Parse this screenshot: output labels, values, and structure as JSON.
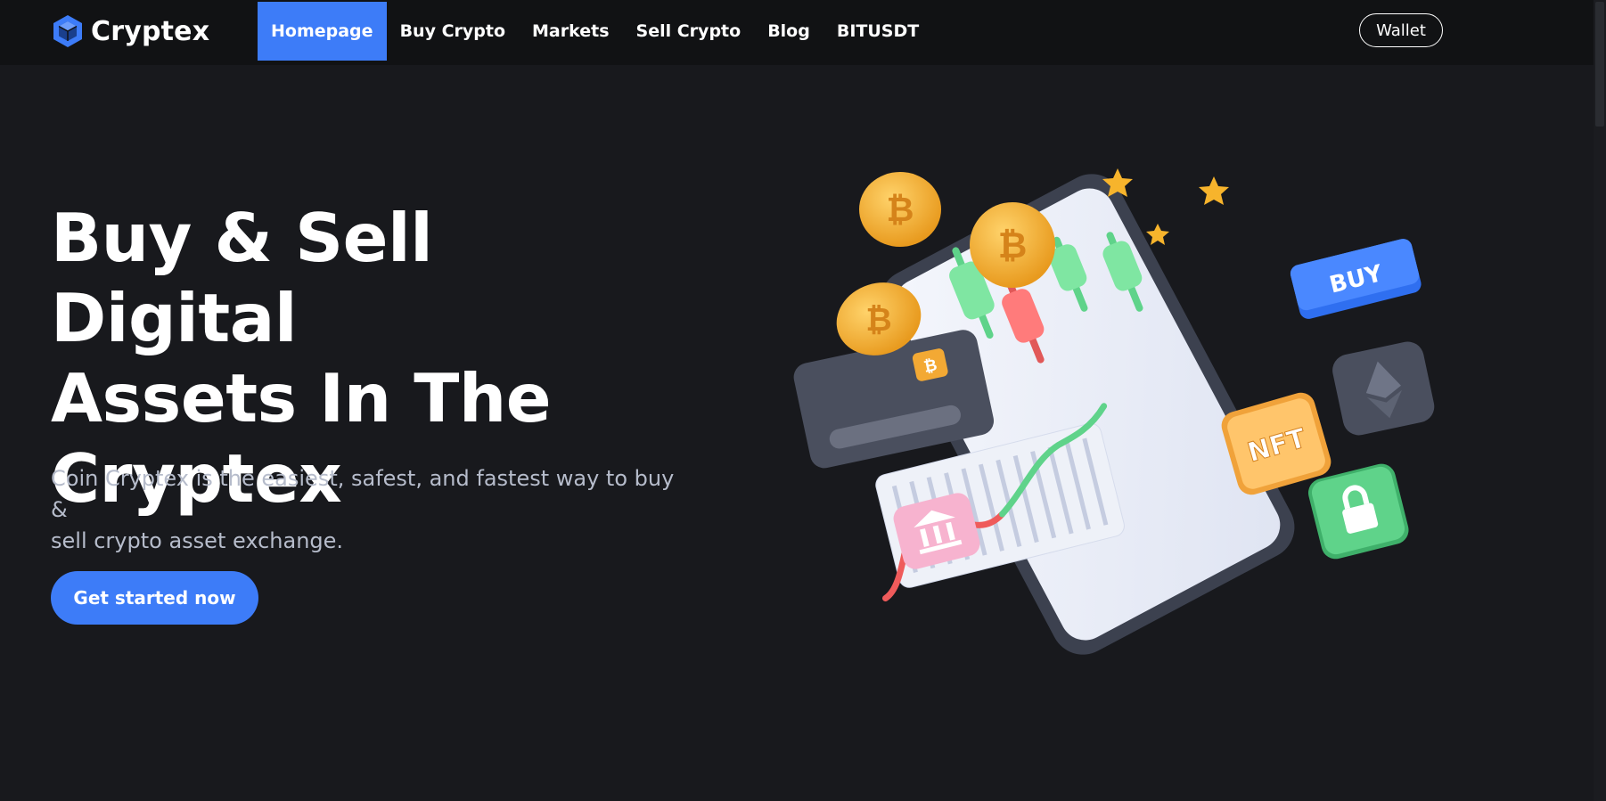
{
  "brand": {
    "name": "Cryptex",
    "icon": "cube-icon",
    "accent": "#3d7cf8"
  },
  "nav": {
    "items": [
      {
        "label": "Homepage",
        "active": true
      },
      {
        "label": "Buy Crypto"
      },
      {
        "label": "Markets"
      },
      {
        "label": "Sell Crypto"
      },
      {
        "label": "Blog"
      },
      {
        "label": "BITUSDT"
      }
    ],
    "wallet_label": "Wallet"
  },
  "hero": {
    "title_lines": [
      "Buy & Sell Digital",
      "Assets In The",
      "Cryptex"
    ],
    "subtitle_lines": [
      "Coin Cryptex is the easiest, safest, and fastest way to buy &",
      "sell crypto asset exchange."
    ],
    "cta_label": "Get started now"
  },
  "illustration": {
    "buy_tag": "BUY",
    "nft_tag": "NFT",
    "coin_symbol": "₿"
  },
  "colors": {
    "background": "#18191d",
    "navbar": "#111214",
    "accent": "#3d7cf8",
    "subtitle": "#b6bccb"
  }
}
